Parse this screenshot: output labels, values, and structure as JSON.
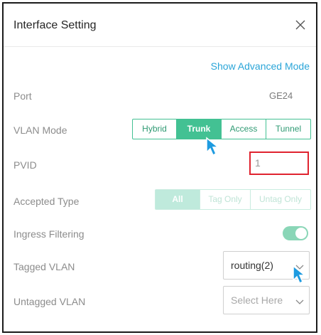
{
  "dialog": {
    "title": "Interface Setting",
    "advanced_link": "Show Advanced Mode"
  },
  "port": {
    "label": "Port",
    "value": "GE24"
  },
  "vlan_mode": {
    "label": "VLAN Mode",
    "options": [
      "Hybrid",
      "Trunk",
      "Access",
      "Tunnel"
    ],
    "selected": "Trunk"
  },
  "pvid": {
    "label": "PVID",
    "value": "1"
  },
  "accepted_type": {
    "label": "Accepted Type",
    "options": [
      "All",
      "Tag Only",
      "Untag Only"
    ],
    "selected": "All",
    "disabled": true
  },
  "ingress_filtering": {
    "label": "Ingress Filtering",
    "enabled": true
  },
  "tagged_vlan": {
    "label": "Tagged VLAN",
    "value": "routing(2)"
  },
  "untagged_vlan": {
    "label": "Untagged VLAN",
    "placeholder": "Select Here"
  },
  "colors": {
    "accent": "#43c193",
    "link": "#2aa5d8",
    "highlight_border": "#e0232f",
    "cursor": "#1e9be0"
  }
}
